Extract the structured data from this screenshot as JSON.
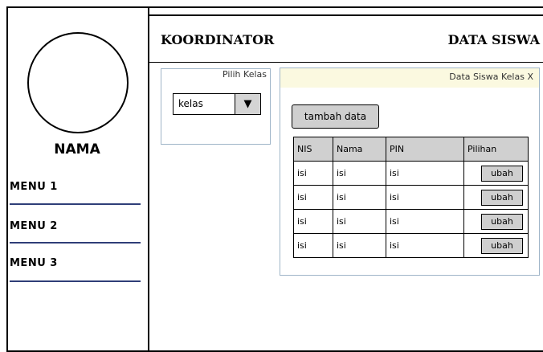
{
  "sidebar": {
    "user_name": "NAMA",
    "menu": [
      {
        "label": "MENU 1"
      },
      {
        "label": "MENU 2"
      },
      {
        "label": "MENU 3"
      }
    ]
  },
  "header": {
    "left_title": "KOORDINATOR",
    "right_title": "DATA SISWA"
  },
  "class_panel": {
    "title": "Pilih Kelas",
    "select_value": "kelas",
    "dropdown_glyph": "▼"
  },
  "students_panel": {
    "title": "Data Siswa Kelas X",
    "add_button_label": "tambah data",
    "columns": [
      "NIS",
      "Nama",
      "PIN",
      "Pilihan"
    ],
    "rows": [
      {
        "nis": "isi",
        "nama": "isi",
        "pin": "isi",
        "action": "ubah"
      },
      {
        "nis": "isi",
        "nama": "isi",
        "pin": "isi",
        "action": "ubah"
      },
      {
        "nis": "isi",
        "nama": "isi",
        "pin": "isi",
        "action": "ubah"
      },
      {
        "nis": "isi",
        "nama": "isi",
        "pin": "isi",
        "action": "ubah"
      }
    ]
  },
  "colors": {
    "menu_underline": "#2f3e78",
    "panel_border": "#9fb5c8",
    "panel_header_bg": "#fbf9e0",
    "button_bg": "#cfcfcf",
    "table_header_bg": "#d0d0d0"
  }
}
